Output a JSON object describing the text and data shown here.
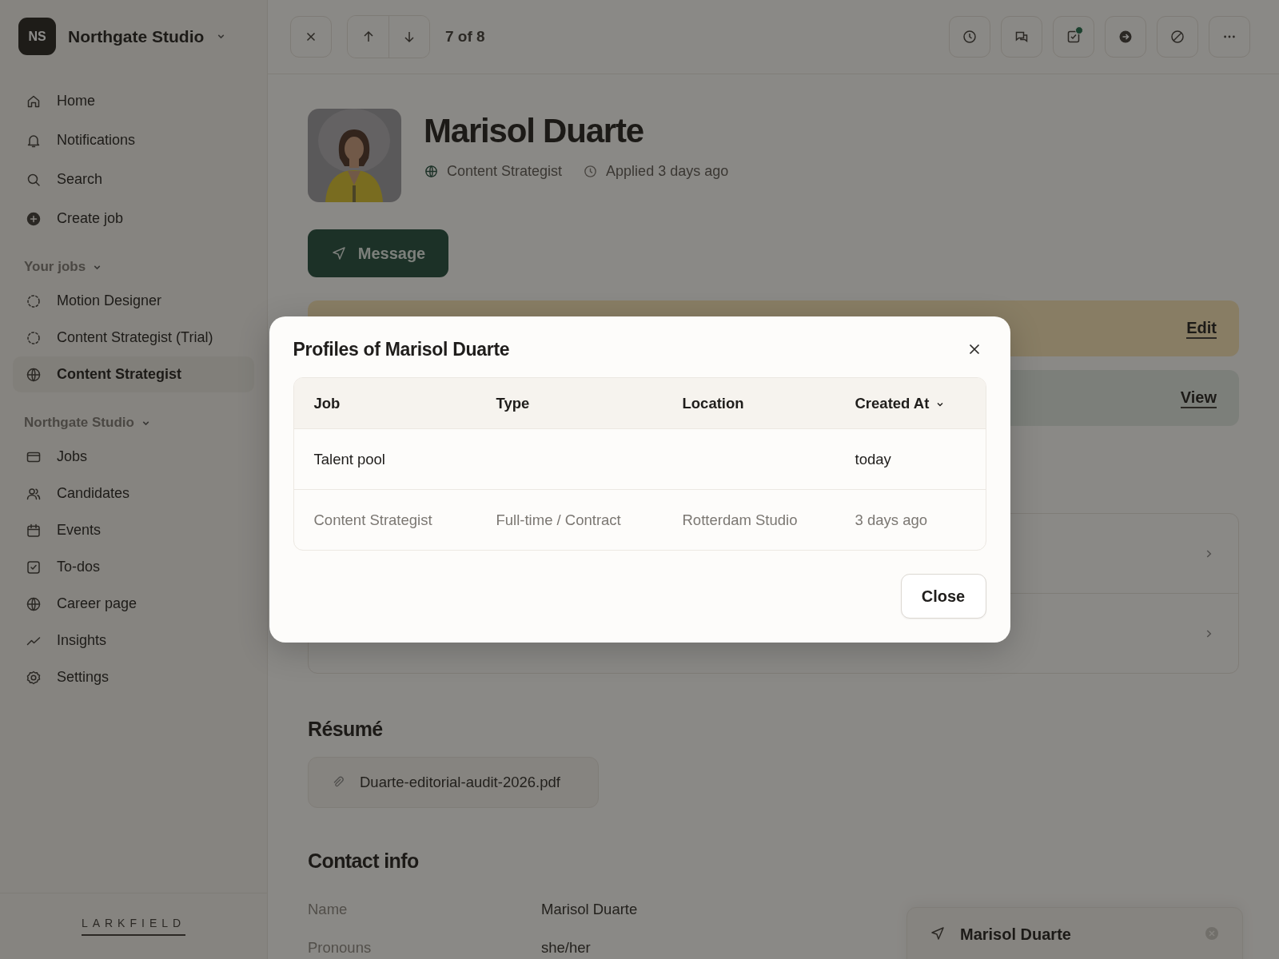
{
  "workspace": {
    "initials": "NS",
    "name": "Northgate Studio"
  },
  "nav": [
    {
      "label": "Home",
      "selected": false
    },
    {
      "label": "Notifications",
      "selected": false
    },
    {
      "label": "Search",
      "selected": false
    },
    {
      "label": "Create job",
      "selected": false
    }
  ],
  "your_jobs": {
    "heading": "Your jobs",
    "items": [
      {
        "label": "Motion Designer",
        "kind": "draft",
        "selected": false
      },
      {
        "label": "Content Strategist (Trial)",
        "kind": "draft",
        "selected": false
      },
      {
        "label": "Content Strategist",
        "kind": "published",
        "selected": true
      }
    ]
  },
  "studio": {
    "heading": "Northgate Studio",
    "items": [
      {
        "label": "Jobs",
        "selected": false
      },
      {
        "label": "Candidates",
        "selected": false
      },
      {
        "label": "Events",
        "selected": false
      },
      {
        "label": "To-dos",
        "selected": false
      },
      {
        "label": "Career page",
        "selected": false
      },
      {
        "label": "Insights",
        "selected": false
      },
      {
        "label": "Settings",
        "selected": false
      }
    ]
  },
  "footer_logo": "LARKFIELD",
  "toolbar": {
    "position": "7 of 8",
    "todos_badge": true
  },
  "candidate": {
    "name": "Marisol Duarte",
    "job": "Content Strategist",
    "applied": "Applied 3 days ago"
  },
  "message_button": "Message",
  "banners": [
    {
      "kind": "warning",
      "action": "Edit"
    },
    {
      "kind": "info",
      "action": "View"
    }
  ],
  "resume": {
    "heading": "Résumé",
    "file": "Duarte-editorial-audit-2026.pdf"
  },
  "contact": {
    "heading": "Contact info",
    "fields": [
      {
        "label": "Name",
        "value": "Marisol Duarte"
      },
      {
        "label": "Pronouns",
        "value": "she/her"
      }
    ]
  },
  "chat_chip": {
    "name": "Marisol Duarte"
  },
  "modal": {
    "title": "Profiles of Marisol Duarte",
    "columns": [
      {
        "label": "Job",
        "sorted": false
      },
      {
        "label": "Type",
        "sorted": false
      },
      {
        "label": "Location",
        "sorted": false
      },
      {
        "label": "Created At",
        "sorted": true
      }
    ],
    "rows": [
      {
        "dimmed": false,
        "cells": {
          "job": "Talent pool",
          "created_at": "today"
        }
      },
      {
        "dimmed": true,
        "cells": {
          "job": "Content Strategist",
          "type": "Full-time / Contract",
          "location": "Rotterdam Studio",
          "created_at": "3 days ago"
        }
      }
    ],
    "close_label": "Close"
  }
}
